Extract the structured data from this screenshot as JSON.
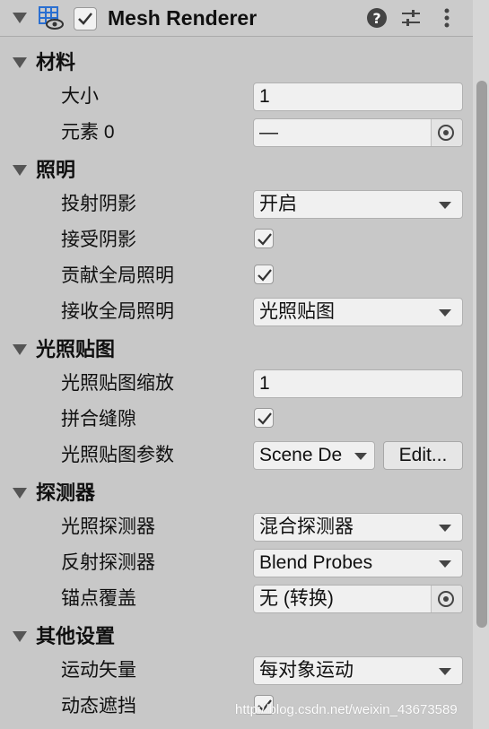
{
  "component": {
    "title": "Mesh Renderer",
    "enabled": true,
    "icons": [
      "help-icon",
      "preset-sliders-icon",
      "more-icon"
    ]
  },
  "sections": {
    "materials": {
      "title": "材料",
      "size_label": "大小",
      "size_value": "1",
      "element_label": "元素 0",
      "element_value": "—"
    },
    "lighting": {
      "title": "照明",
      "cast_shadows_label": "投射阴影",
      "cast_shadows_value": "开启",
      "receive_shadows_label": "接受阴影",
      "receive_shadows_checked": true,
      "contribute_gi_label": "贡献全局照明",
      "contribute_gi_checked": true,
      "receive_gi_label": "接收全局照明",
      "receive_gi_value": "光照贴图"
    },
    "lightmapping": {
      "title": "光照贴图",
      "scale_label": "光照贴图缩放",
      "scale_value": "1",
      "stitch_label": "拼合缝隙",
      "stitch_checked": true,
      "params_label": "光照贴图参数",
      "params_value": "Scene De",
      "edit_label": "Edit..."
    },
    "probes": {
      "title": "探测器",
      "light_probes_label": "光照探测器",
      "light_probes_value": "混合探测器",
      "reflection_probes_label": "反射探测器",
      "reflection_probes_value": "Blend Probes",
      "anchor_label": "锚点覆盖",
      "anchor_value": "无 (转换)"
    },
    "other": {
      "title": "其他设置",
      "motion_vectors_label": "运动矢量",
      "motion_vectors_value": "每对象运动",
      "dynamic_occlusion_label": "动态遮挡",
      "dynamic_occlusion_checked": true
    }
  },
  "watermark": "http://blog.csdn.net/weixin_43673589"
}
